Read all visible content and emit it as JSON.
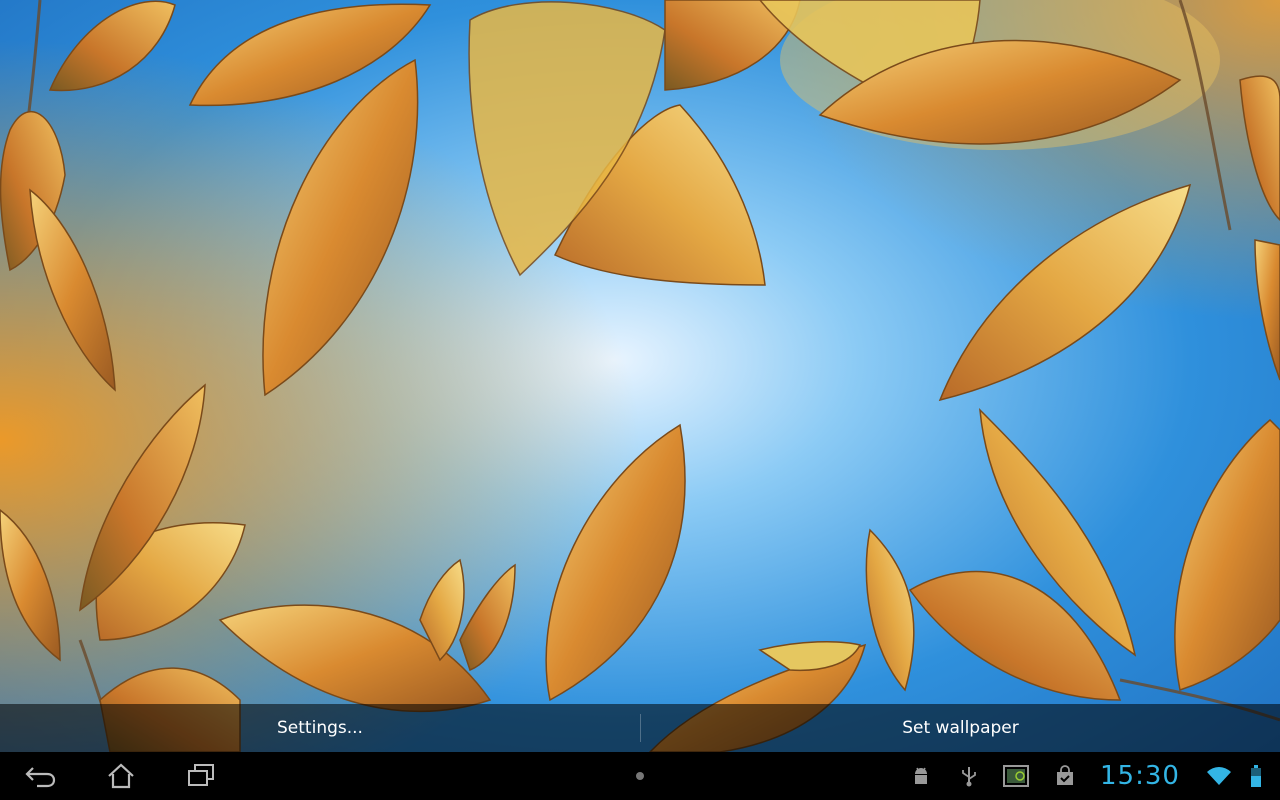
{
  "wallpaper": {
    "sky_color": "#3a9be0",
    "leaf_colors": [
      "#e8a23a",
      "#c97a2a",
      "#f2c55a",
      "#b5652a",
      "#6b5a20"
    ]
  },
  "action_bar": {
    "settings_label": "Settings...",
    "set_wallpaper_label": "Set wallpaper"
  },
  "system_bar": {
    "nav_icons": [
      "back-icon",
      "home-icon",
      "recent-apps-icon"
    ],
    "center_indicator": "menu-dot-icon",
    "notification_icons": [
      "android-debug-icon",
      "usb-icon",
      "screenshot-icon",
      "store-bag-icon"
    ],
    "clock": "15:30",
    "status_icons": [
      "wifi-icon",
      "battery-icon"
    ],
    "accent_color": "#33b5e5"
  }
}
